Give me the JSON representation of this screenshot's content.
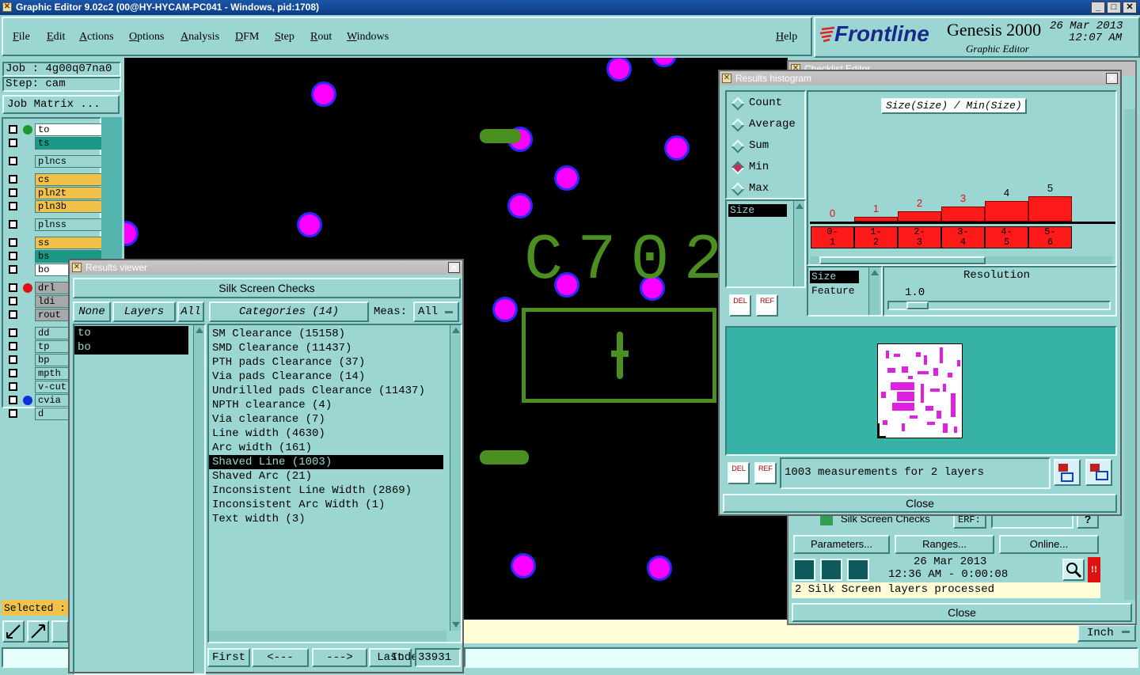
{
  "window": {
    "title": "Graphic Editor 9.02c2 (00@HY-HYCAM-PC041 - Windows, pid:1708)"
  },
  "menu": [
    "File",
    "Edit",
    "Actions",
    "Options",
    "Analysis",
    "DFM",
    "Step",
    "Rout",
    "Windows"
  ],
  "help_label": "Help",
  "brand": {
    "logo": "Frontline",
    "product": "Genesis 2000",
    "subtitle": "Graphic Editor",
    "date": "26 Mar 2013",
    "time": "12:07 AM"
  },
  "job": {
    "job_label": "Job : 4g00q07na0",
    "step_label": "Step: cam",
    "matrix_button": "Job Matrix ..."
  },
  "layers": [
    {
      "name": "to",
      "color": "#ffffff"
    },
    {
      "name": "ts",
      "color": "#1a9a86"
    },
    {
      "name": "plncs",
      "color": "#9cd6d2"
    },
    {
      "name": "cs",
      "color": "#f2c14a"
    },
    {
      "name": "pln2t",
      "color": "#f2c14a"
    },
    {
      "name": "pln3b",
      "color": "#f2c14a"
    },
    {
      "name": "plnss",
      "color": "#9cd6d2"
    },
    {
      "name": "ss",
      "color": "#f2c14a"
    },
    {
      "name": "bs",
      "color": "#1a9a86"
    },
    {
      "name": "bo",
      "color": "#ffffff"
    },
    {
      "name": "drl",
      "color": "#a8a8a8"
    },
    {
      "name": "ldi",
      "color": "#a8a8a8"
    },
    {
      "name": "rout",
      "color": "#a8a8a8"
    },
    {
      "name": "dd",
      "color": "#9cd6d2"
    },
    {
      "name": "tp",
      "color": "#9cd6d2"
    },
    {
      "name": "bp",
      "color": "#9cd6d2"
    },
    {
      "name": "mpth",
      "color": "#9cd6d2"
    },
    {
      "name": "v-cut",
      "color": "#9cd6d2"
    },
    {
      "name": "cvia",
      "color": "#9cd6d2"
    },
    {
      "name": "d",
      "color": "#9cd6d2"
    }
  ],
  "selected_label": "Selected :",
  "board_text": "C702",
  "units": "Inch",
  "results_viewer": {
    "title": "Results viewer",
    "heading": "Silk Screen Checks",
    "none_btn": "None",
    "layers_btn": "Layers",
    "all_btn": "All",
    "categories_btn": "Categories (14)",
    "meas_label": "Meas:",
    "meas_value": "All",
    "layer_items": [
      "to",
      "bo"
    ],
    "categories": [
      "SM Clearance (15158)",
      "SMD Clearance (11437)",
      "PTH pads Clearance (37)",
      "Via pads Clearance (14)",
      "Undrilled pads Clearance (11437)",
      "NPTH clearance (4)",
      "Via clearance (7)",
      "Line width (4630)",
      "Arc width (161)",
      "Shaved Line (1003)",
      "Shaved Arc (21)",
      "Inconsistent Line Width (2869)",
      "Inconsistent Arc Width (1)",
      "Text width (3)"
    ],
    "selected_category": 9,
    "first_btn": "First",
    "prev_btn": "<---",
    "next_btn": "--->",
    "last_btn": "Last",
    "index_label": "Index:",
    "index_value": "33931"
  },
  "histogram": {
    "title": "Results histogram",
    "modes": [
      "Count",
      "Average",
      "Sum",
      "Min",
      "Max"
    ],
    "selected_mode": "Min",
    "chart_title": "Size(Size) / Min(Size)",
    "bar_labels": [
      "0",
      "1",
      "2",
      "3",
      "4",
      "5"
    ],
    "bar_values": [
      0,
      1,
      2,
      3,
      4,
      5
    ],
    "bins": [
      [
        "0-",
        "1"
      ],
      [
        "1-",
        "2"
      ],
      [
        "2-",
        "3"
      ],
      [
        "3-",
        "4"
      ],
      [
        "4-",
        "5"
      ],
      [
        "5-",
        "6"
      ]
    ],
    "list_item": "Size",
    "attr_items": [
      "Size",
      "Feature"
    ],
    "resolution_label": "Resolution",
    "resolution_value": "1.0",
    "del_label": "DEL",
    "ref_label": "REF",
    "status": "1003 measurements for 2 layers",
    "close": "Close"
  },
  "checklist": {
    "title": "Checklist Editor",
    "row_text": "Silk Screen Checks",
    "erf_label": "ERF:",
    "params_btn": "Parameters...",
    "ranges_btn": "Ranges...",
    "online_btn": "Online...",
    "run_date": "26 Mar 2013",
    "run_time": "12:36 AM - 0:00:08",
    "message": "2 Silk Screen layers processed",
    "close": "Close"
  },
  "colors": {
    "panel": "#9cd6d2",
    "accent_green": "#4a8f20",
    "pad_fill": "#ff00ff",
    "pad_ring": "#2828ff",
    "bar": "#ff1a1a"
  }
}
